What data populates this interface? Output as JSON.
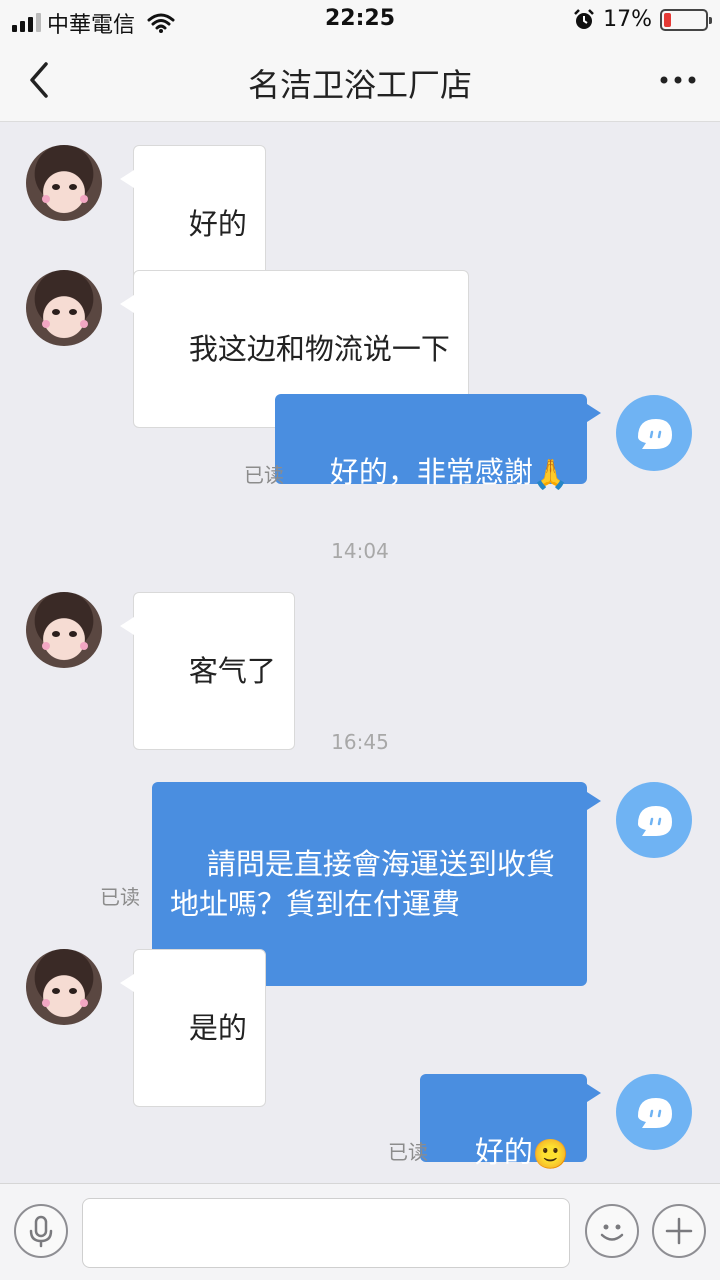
{
  "status": {
    "carrier": "中華電信",
    "time": "22:25",
    "battery_percent": "17%",
    "battery_level": 0.17,
    "signal_bars": 3,
    "colors": {
      "battery_low": "#e53935"
    }
  },
  "header": {
    "title": "名洁卫浴工厂店",
    "back_icon": "chevron-left-icon",
    "more_icon": "more-dots-icon"
  },
  "messages": [
    {
      "side": "in",
      "text": "好的"
    },
    {
      "side": "in",
      "text": "我这边和物流说一下"
    },
    {
      "side": "out",
      "text": "好的，非常感謝",
      "emoji": "🙏",
      "read": "已读"
    },
    {
      "timestamp": "14:04"
    },
    {
      "side": "in",
      "text": "客气了"
    },
    {
      "timestamp": "16:45"
    },
    {
      "side": "out",
      "text": "請問是直接會海運送到收貨地址嗎？貨到在付運費",
      "read": "已读"
    },
    {
      "side": "in",
      "text": "是的"
    },
    {
      "side": "out",
      "text": "好的",
      "emoji": "🙂",
      "read": "已读"
    }
  ],
  "input_bar": {
    "voice_icon": "microphone-icon",
    "emoji_icon": "smiley-icon",
    "add_icon": "plus-icon",
    "message_value": "",
    "message_placeholder": ""
  },
  "colors": {
    "outgoing_bubble": "#4a8ee0",
    "incoming_bubble": "#ffffff",
    "chat_background": "#ececf1",
    "self_avatar": "#6fb3f3"
  }
}
